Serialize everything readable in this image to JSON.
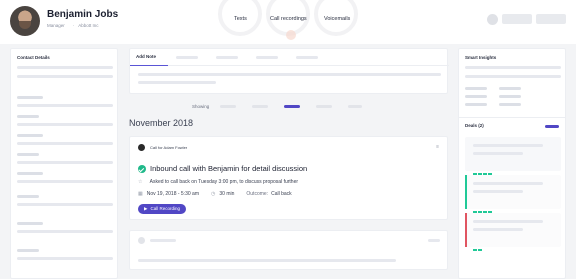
{
  "profile": {
    "name": "Benjamin Jobs",
    "role": "Manager",
    "company": "Abbott Inc"
  },
  "header_tabs": [
    "Texts",
    "Call recordings",
    "Voicemails"
  ],
  "left_panel": {
    "title": "Contact Details"
  },
  "note_panel": {
    "active_tab": "Add Note"
  },
  "feed": {
    "showing_label": "Showing",
    "month": "November 2018"
  },
  "activity": {
    "call_for": "Call for Adam Fowler",
    "menu_icon": "kebab-dots-icon",
    "title": "Inbound call with Benjamin for detail discussion",
    "description": "Asked to call back on Tuesday 3:00 pm, to discuss proposal further",
    "date": "Nov 19, 2018 - 5:30 am",
    "duration": "30 min",
    "outcome_label": "Outcome:",
    "outcome_value": "Call back",
    "recording_button": "Call Recording"
  },
  "right_panel": {
    "title": "Smart Insights",
    "deals_label": "Deals (2)"
  },
  "colors": {
    "accent": "#5147c5",
    "success": "#20b98a",
    "deal_won": "#20c997",
    "deal_lost": "#e05561"
  }
}
